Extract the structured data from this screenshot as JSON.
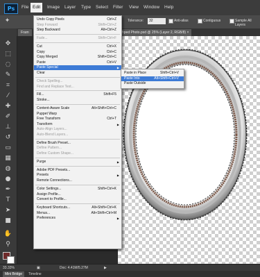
{
  "app": {
    "logo": "Ps"
  },
  "menubar": {
    "items": [
      "File",
      "Edit",
      "Image",
      "Layer",
      "Type",
      "Select",
      "Filter",
      "View",
      "Window",
      "Help"
    ]
  },
  "options": {
    "tolerance_label": "Tolerance:",
    "tolerance_value": "32",
    "antialias": "Anti-alias",
    "contiguous": "Contiguous",
    "sample_all": "Sample All Layers"
  },
  "tabs": {
    "frame": "Fram",
    "doc": "hped Photo.psd @ 25% (Layer 2, RGB/8) ×"
  },
  "edit_menu": [
    {
      "label": "Undo Copy Pixels",
      "shortcut": "Ctrl+Z",
      "state": "normal"
    },
    {
      "label": "Step Forward",
      "shortcut": "Shift+Ctrl+Z",
      "state": "disabled"
    },
    {
      "label": "Step Backward",
      "shortcut": "Alt+Ctrl+Z",
      "state": "normal"
    },
    {
      "sep": true
    },
    {
      "label": "Fade...",
      "shortcut": "Shift+Ctrl+F",
      "state": "disabled"
    },
    {
      "sep": true
    },
    {
      "label": "Cut",
      "shortcut": "Ctrl+X",
      "state": "normal"
    },
    {
      "label": "Copy",
      "shortcut": "Ctrl+C",
      "state": "normal"
    },
    {
      "label": "Copy Merged",
      "shortcut": "Shift+Ctrl+C",
      "state": "normal"
    },
    {
      "label": "Paste",
      "shortcut": "Ctrl+V",
      "state": "normal"
    },
    {
      "label": "Paste Special",
      "shortcut": "",
      "state": "highlight",
      "submenu": true
    },
    {
      "label": "Clear",
      "shortcut": "",
      "state": "normal"
    },
    {
      "sep": true
    },
    {
      "label": "Check Spelling...",
      "shortcut": "",
      "state": "disabled"
    },
    {
      "label": "Find and Replace Text...",
      "shortcut": "",
      "state": "disabled"
    },
    {
      "sep": true
    },
    {
      "label": "Fill...",
      "shortcut": "Shift+F5",
      "state": "normal"
    },
    {
      "label": "Stroke...",
      "shortcut": "",
      "state": "normal"
    },
    {
      "sep": true
    },
    {
      "label": "Content-Aware Scale",
      "shortcut": "Alt+Shift+Ctrl+C",
      "state": "normal"
    },
    {
      "label": "Puppet Warp",
      "shortcut": "",
      "state": "normal"
    },
    {
      "label": "Free Transform",
      "shortcut": "Ctrl+T",
      "state": "normal"
    },
    {
      "label": "Transform",
      "shortcut": "",
      "state": "normal",
      "submenu": true
    },
    {
      "label": "Auto-Align Layers...",
      "shortcut": "",
      "state": "disabled"
    },
    {
      "label": "Auto-Blend Layers...",
      "shortcut": "",
      "state": "disabled"
    },
    {
      "sep": true
    },
    {
      "label": "Define Brush Preset...",
      "shortcut": "",
      "state": "normal"
    },
    {
      "label": "Define Pattern...",
      "shortcut": "",
      "state": "disabled"
    },
    {
      "label": "Define Custom Shape...",
      "shortcut": "",
      "state": "disabled"
    },
    {
      "sep": true
    },
    {
      "label": "Purge",
      "shortcut": "",
      "state": "normal",
      "submenu": true
    },
    {
      "sep": true
    },
    {
      "label": "Adobe PDF Presets...",
      "shortcut": "",
      "state": "normal"
    },
    {
      "label": "Presets",
      "shortcut": "",
      "state": "normal",
      "submenu": true
    },
    {
      "label": "Remote Connections...",
      "shortcut": "",
      "state": "normal"
    },
    {
      "sep": true
    },
    {
      "label": "Color Settings...",
      "shortcut": "Shift+Ctrl+K",
      "state": "normal"
    },
    {
      "label": "Assign Profile...",
      "shortcut": "",
      "state": "normal"
    },
    {
      "label": "Convert to Profile...",
      "shortcut": "",
      "state": "normal"
    },
    {
      "sep": true
    },
    {
      "label": "Keyboard Shortcuts...",
      "shortcut": "Alt+Shift+Ctrl+K",
      "state": "normal"
    },
    {
      "label": "Menus...",
      "shortcut": "Alt+Shift+Ctrl+M",
      "state": "normal"
    },
    {
      "label": "Preferences",
      "shortcut": "",
      "state": "normal",
      "submenu": true
    }
  ],
  "paste_special_menu": [
    {
      "label": "Paste in Place",
      "shortcut": "Shift+Ctrl+V",
      "state": "normal"
    },
    {
      "label": "Paste Into",
      "shortcut": "Alt+Shift+Ctrl+V",
      "state": "highlight"
    },
    {
      "label": "Paste Outside",
      "shortcut": "",
      "state": "normal"
    }
  ],
  "status": {
    "zoom": "33.33%",
    "doc": "Doc: 4.41M/5.27M"
  },
  "bottom_tabs": [
    "Mini Bridge",
    "Timeline"
  ],
  "colors": {
    "highlight": "#3d7bd6",
    "menu_bg": "#f2f2f2",
    "chrome": "#3c3c3c"
  }
}
